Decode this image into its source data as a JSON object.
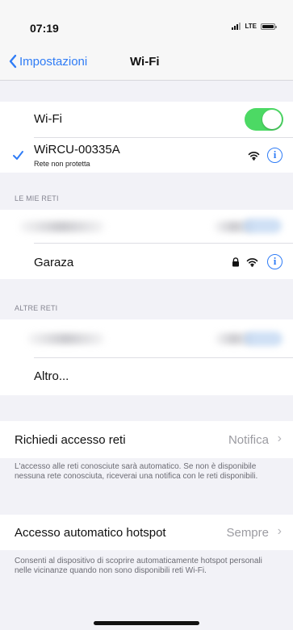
{
  "status_bar": {
    "time": "07:19",
    "network": "LTE"
  },
  "nav": {
    "back_label": "Impostazioni",
    "title": "Wi-Fi"
  },
  "wifi": {
    "label": "Wi-Fi",
    "enabled": true,
    "connected_network": "WiRCU-00335A",
    "connected_status": "Rete non protetta"
  },
  "my_networks": {
    "title": "LE MIE RETI",
    "items": [
      {
        "name": "Garaza",
        "locked": true
      }
    ]
  },
  "other_networks": {
    "title": "ALTRE RETI",
    "other_label": "Altro..."
  },
  "settings": [
    {
      "label": "Richiedi accesso reti",
      "value": "Notifica",
      "description": "L'accesso alle reti conosciute sarà automatico. Se non è disponibile nessuna rete conosciuta, riceverai una notifica con le reti disponibili."
    },
    {
      "label": "Accesso automatico hotspot",
      "value": "Sempre",
      "description": "Consenti al dispositivo di scoprire automaticamente hotspot personali nelle vicinanze quando non sono disponibili reti Wi-Fi."
    }
  ],
  "colors": {
    "accent": "#2f7cf6",
    "toggle_on": "#4cd964",
    "background": "#f2f2f7"
  },
  "icons": [
    "wifi-icon",
    "info-icon",
    "lock-icon",
    "checkmark-icon",
    "chevron-left-icon",
    "chevron-right-icon"
  ]
}
